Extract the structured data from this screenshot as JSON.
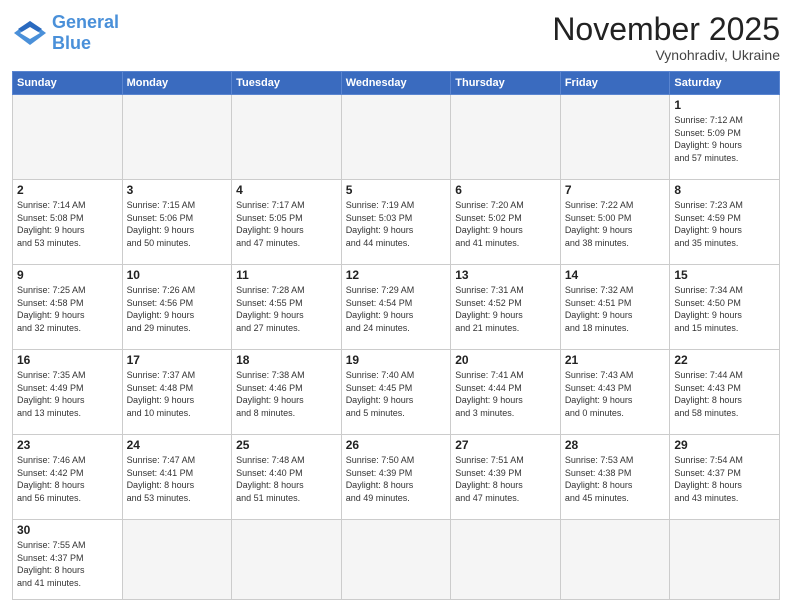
{
  "logo": {
    "text_general": "General",
    "text_blue": "Blue"
  },
  "header": {
    "month": "November 2025",
    "location": "Vynohradiv, Ukraine"
  },
  "weekdays": [
    "Sunday",
    "Monday",
    "Tuesday",
    "Wednesday",
    "Thursday",
    "Friday",
    "Saturday"
  ],
  "weeks": [
    [
      {
        "day": "",
        "info": ""
      },
      {
        "day": "",
        "info": ""
      },
      {
        "day": "",
        "info": ""
      },
      {
        "day": "",
        "info": ""
      },
      {
        "day": "",
        "info": ""
      },
      {
        "day": "",
        "info": ""
      },
      {
        "day": "1",
        "info": "Sunrise: 7:12 AM\nSunset: 5:09 PM\nDaylight: 9 hours\nand 57 minutes."
      }
    ],
    [
      {
        "day": "2",
        "info": "Sunrise: 7:14 AM\nSunset: 5:08 PM\nDaylight: 9 hours\nand 53 minutes."
      },
      {
        "day": "3",
        "info": "Sunrise: 7:15 AM\nSunset: 5:06 PM\nDaylight: 9 hours\nand 50 minutes."
      },
      {
        "day": "4",
        "info": "Sunrise: 7:17 AM\nSunset: 5:05 PM\nDaylight: 9 hours\nand 47 minutes."
      },
      {
        "day": "5",
        "info": "Sunrise: 7:19 AM\nSunset: 5:03 PM\nDaylight: 9 hours\nand 44 minutes."
      },
      {
        "day": "6",
        "info": "Sunrise: 7:20 AM\nSunset: 5:02 PM\nDaylight: 9 hours\nand 41 minutes."
      },
      {
        "day": "7",
        "info": "Sunrise: 7:22 AM\nSunset: 5:00 PM\nDaylight: 9 hours\nand 38 minutes."
      },
      {
        "day": "8",
        "info": "Sunrise: 7:23 AM\nSunset: 4:59 PM\nDaylight: 9 hours\nand 35 minutes."
      }
    ],
    [
      {
        "day": "9",
        "info": "Sunrise: 7:25 AM\nSunset: 4:58 PM\nDaylight: 9 hours\nand 32 minutes."
      },
      {
        "day": "10",
        "info": "Sunrise: 7:26 AM\nSunset: 4:56 PM\nDaylight: 9 hours\nand 29 minutes."
      },
      {
        "day": "11",
        "info": "Sunrise: 7:28 AM\nSunset: 4:55 PM\nDaylight: 9 hours\nand 27 minutes."
      },
      {
        "day": "12",
        "info": "Sunrise: 7:29 AM\nSunset: 4:54 PM\nDaylight: 9 hours\nand 24 minutes."
      },
      {
        "day": "13",
        "info": "Sunrise: 7:31 AM\nSunset: 4:52 PM\nDaylight: 9 hours\nand 21 minutes."
      },
      {
        "day": "14",
        "info": "Sunrise: 7:32 AM\nSunset: 4:51 PM\nDaylight: 9 hours\nand 18 minutes."
      },
      {
        "day": "15",
        "info": "Sunrise: 7:34 AM\nSunset: 4:50 PM\nDaylight: 9 hours\nand 15 minutes."
      }
    ],
    [
      {
        "day": "16",
        "info": "Sunrise: 7:35 AM\nSunset: 4:49 PM\nDaylight: 9 hours\nand 13 minutes."
      },
      {
        "day": "17",
        "info": "Sunrise: 7:37 AM\nSunset: 4:48 PM\nDaylight: 9 hours\nand 10 minutes."
      },
      {
        "day": "18",
        "info": "Sunrise: 7:38 AM\nSunset: 4:46 PM\nDaylight: 9 hours\nand 8 minutes."
      },
      {
        "day": "19",
        "info": "Sunrise: 7:40 AM\nSunset: 4:45 PM\nDaylight: 9 hours\nand 5 minutes."
      },
      {
        "day": "20",
        "info": "Sunrise: 7:41 AM\nSunset: 4:44 PM\nDaylight: 9 hours\nand 3 minutes."
      },
      {
        "day": "21",
        "info": "Sunrise: 7:43 AM\nSunset: 4:43 PM\nDaylight: 9 hours\nand 0 minutes."
      },
      {
        "day": "22",
        "info": "Sunrise: 7:44 AM\nSunset: 4:43 PM\nDaylight: 8 hours\nand 58 minutes."
      }
    ],
    [
      {
        "day": "23",
        "info": "Sunrise: 7:46 AM\nSunset: 4:42 PM\nDaylight: 8 hours\nand 56 minutes."
      },
      {
        "day": "24",
        "info": "Sunrise: 7:47 AM\nSunset: 4:41 PM\nDaylight: 8 hours\nand 53 minutes."
      },
      {
        "day": "25",
        "info": "Sunrise: 7:48 AM\nSunset: 4:40 PM\nDaylight: 8 hours\nand 51 minutes."
      },
      {
        "day": "26",
        "info": "Sunrise: 7:50 AM\nSunset: 4:39 PM\nDaylight: 8 hours\nand 49 minutes."
      },
      {
        "day": "27",
        "info": "Sunrise: 7:51 AM\nSunset: 4:39 PM\nDaylight: 8 hours\nand 47 minutes."
      },
      {
        "day": "28",
        "info": "Sunrise: 7:53 AM\nSunset: 4:38 PM\nDaylight: 8 hours\nand 45 minutes."
      },
      {
        "day": "29",
        "info": "Sunrise: 7:54 AM\nSunset: 4:37 PM\nDaylight: 8 hours\nand 43 minutes."
      }
    ],
    [
      {
        "day": "30",
        "info": "Sunrise: 7:55 AM\nSunset: 4:37 PM\nDaylight: 8 hours\nand 41 minutes."
      },
      {
        "day": "",
        "info": ""
      },
      {
        "day": "",
        "info": ""
      },
      {
        "day": "",
        "info": ""
      },
      {
        "day": "",
        "info": ""
      },
      {
        "day": "",
        "info": ""
      },
      {
        "day": "",
        "info": ""
      }
    ]
  ]
}
